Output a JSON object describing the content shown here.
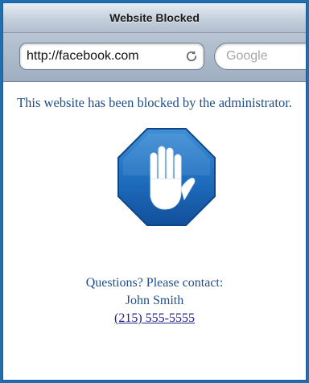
{
  "window": {
    "title": "Website Blocked"
  },
  "toolbar": {
    "url": "http://facebook.com",
    "reload_icon": "reload-icon",
    "search_placeholder": "Google"
  },
  "content": {
    "message": "This website has been blocked by the administrator.",
    "stop_sign_icon": "stop-hand-icon",
    "contact_heading": "Questions? Please contact:",
    "contact_name": "John Smith",
    "contact_phone": "(215) 555-5555"
  },
  "colors": {
    "accent_blue": "#1f6fb0",
    "text_blue": "#1f4f8a",
    "link_color": "#23238e"
  }
}
